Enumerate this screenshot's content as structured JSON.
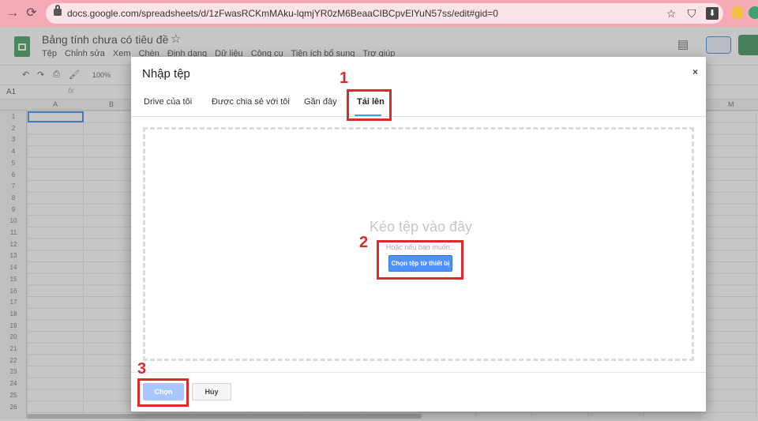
{
  "browser": {
    "url": "docs.google.com/spreadsheets/d/1zFwasRCKmMAku-lqmjYR0zM6BeaaCIBCpvElYuN57ss/edit#gid=0"
  },
  "sheets": {
    "title": "Bảng tính chưa có tiêu đề",
    "menu": [
      "Tệp",
      "Chỉnh sửa",
      "Xem",
      "Chèn",
      "Định dạng",
      "Dữ liệu",
      "Công cụ",
      "Tiện ích bổ sung",
      "Trợ giúp"
    ],
    "zoom": "100%",
    "cell_ref": "A1",
    "fx": "fx",
    "columns": [
      "A",
      "B",
      "M"
    ],
    "rows": [
      "1",
      "2",
      "3",
      "4",
      "5",
      "6",
      "7",
      "8",
      "9",
      "10",
      "11",
      "12",
      "13",
      "14",
      "15",
      "16",
      "17",
      "18",
      "19",
      "20",
      "21",
      "22",
      "23",
      "24",
      "25",
      "26"
    ]
  },
  "dialog": {
    "title": "Nhập tệp",
    "close": "×",
    "tabs": [
      "Drive của tôi",
      "Được chia sẻ với tôi",
      "Gần đây",
      "Tải lên"
    ],
    "drop_title": "Kéo tệp vào đây",
    "drop_sub": "Hoặc nếu bạn muốn...",
    "pick_button": "Chọn tệp từ thiết bị",
    "select_button": "Chọn",
    "cancel_button": "Hủy"
  },
  "annotations": [
    "1",
    "2",
    "3"
  ],
  "colors": {
    "accent": "#4d90fe",
    "annotation": "#d92b2b",
    "sheets_green": "#1e8e3e"
  }
}
